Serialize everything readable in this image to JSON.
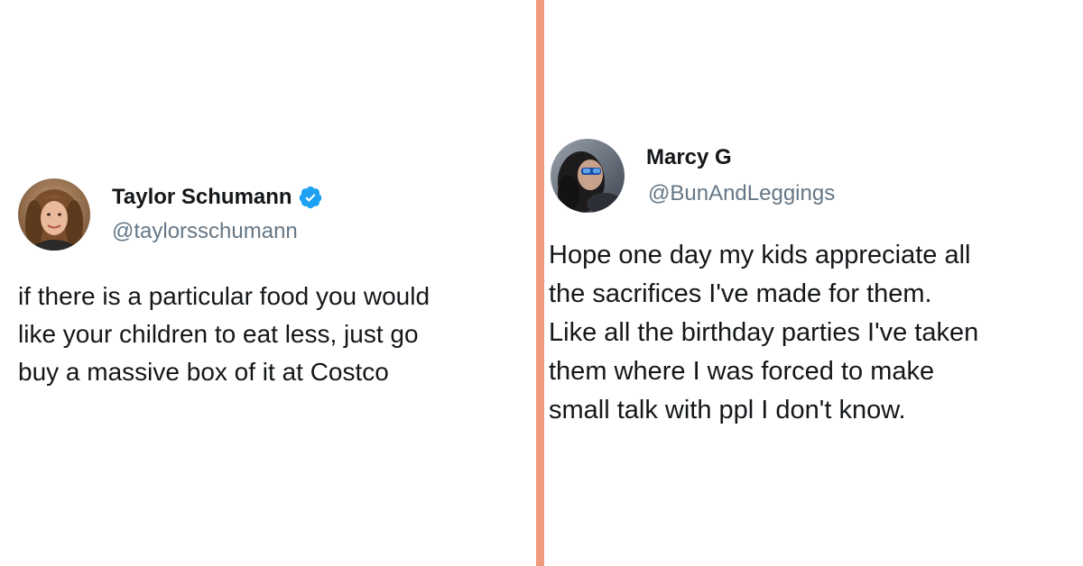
{
  "layout": {
    "divider_color": "#ef9a7d",
    "background_color": "#ffffff"
  },
  "left_tweet": {
    "display_name": "Taylor Schumann",
    "handle": "@taylorsschumann",
    "verified": true,
    "verified_icon": "verified-badge-icon",
    "verified_color": "#1da1f2",
    "avatar_icon": "avatar-photo",
    "body_lines": [
      "if there is a particular food you would",
      "like your children to eat less, just go",
      "buy a massive box of it at Costco"
    ]
  },
  "right_tweet": {
    "display_name": "Marcy G",
    "handle": "@BunAndLeggings",
    "verified": false,
    "avatar_icon": "avatar-photo",
    "body_lines": [
      "Hope one day my kids appreciate all",
      "the sacrifices I've made for them.",
      "Like all the birthday parties I've taken",
      "them where I was forced to make",
      "small talk with ppl I don't know."
    ]
  }
}
